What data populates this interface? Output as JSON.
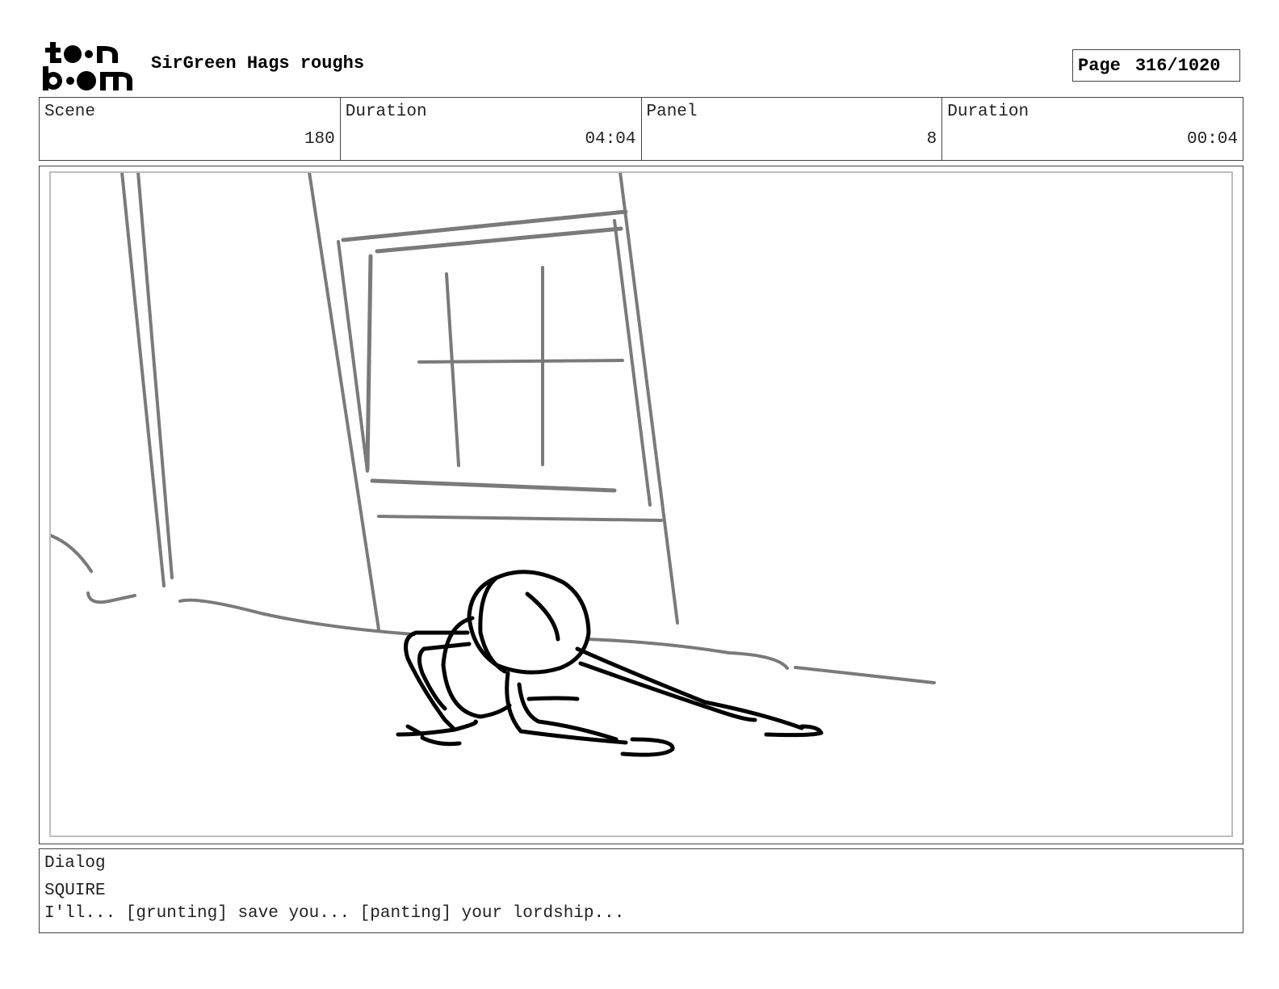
{
  "header": {
    "logo_text": "toonboom",
    "title": "SirGreen Hags roughs",
    "page_label": "Page",
    "page_value": "316/1020"
  },
  "info": {
    "scene_label": "Scene",
    "scene_value": "180",
    "scene_duration_label": "Duration",
    "scene_duration_value": "04:04",
    "panel_label": "Panel",
    "panel_value": "8",
    "panel_duration_label": "Duration",
    "panel_duration_value": "00:04"
  },
  "dialog": {
    "label": "Dialog",
    "speaker": "SQUIRE",
    "line": "I'll... [grunting] save you... [panting] your lordship..."
  },
  "colors": {
    "background_strokes": "#7a7a7a",
    "character_strokes": "#000000",
    "frame_border": "#444444",
    "inner_border": "#bdbdbd"
  }
}
